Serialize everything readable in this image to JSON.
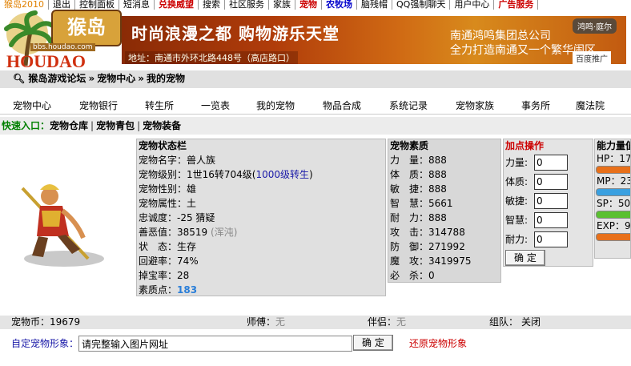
{
  "topnav": {
    "items": [
      "猴岛2010",
      "退出",
      "控制面板",
      "短消息",
      "兑换威望",
      "搜索",
      "社区服务",
      "家族",
      "宠物",
      "农牧场",
      "脑残帽",
      "QQ强制聊天",
      "用户中心",
      "广告服务"
    ]
  },
  "logo": {
    "main": "猴岛",
    "url": "bbs.houdao.com",
    "sub": "HOUDAO"
  },
  "banner": {
    "slogan": "时尚浪漫之都 购物游乐天堂",
    "address": "地址：南通市外环北路448号（高店路口）",
    "company": "南通鸿鸣集团总公司",
    "tagline": "全力打造南通又一个繁华闹区",
    "brand": "鸿鸣·庭尔",
    "ad_tag": "百度推广"
  },
  "breadcrumb": {
    "items": [
      "猴岛游戏论坛",
      "宠物中心",
      "我的宠物"
    ],
    "sep": "»"
  },
  "menu": {
    "items": [
      "宠物中心",
      "宠物银行",
      "转生所",
      "一览表",
      "我的宠物",
      "物品合成",
      "系统记录",
      "宠物家族",
      "事务所",
      "魔法院"
    ]
  },
  "quick": {
    "label": "快速入口：",
    "links": [
      "宠物仓库",
      "宠物青包",
      "宠物装备"
    ],
    "sep": "|"
  },
  "pet_status": {
    "title": "宠物状态栏",
    "name": "宠物名字：兽人族",
    "level_prefix": "宠物级别：1世16转704级(",
    "level_link": "1000级转生",
    "level_suffix": ")",
    "gender": "宠物性别：雄",
    "attribute": "宠物属性：土",
    "loyalty": "忠诚度：-25 猜疑",
    "karma_prefix": "善恶值：38519",
    "karma_tag": "(浑沌)",
    "state": "状　态：生存",
    "evade": "回避率：74%",
    "droprate": "掉宝率：28",
    "points_label": "素质点：",
    "points_value": "183"
  },
  "pet_attr": {
    "title": "宠物素质",
    "rows": [
      {
        "label": "力　量：",
        "value": "888"
      },
      {
        "label": "体　质：",
        "value": "888"
      },
      {
        "label": "敏　捷：",
        "value": "888"
      },
      {
        "label": "智　慧：",
        "value": "5661"
      },
      {
        "label": "耐　力：",
        "value": "888"
      },
      {
        "label": "攻　击：",
        "value": "314788"
      },
      {
        "label": "防　御：",
        "value": "271992"
      },
      {
        "label": "魔　攻：",
        "value": "3419975"
      },
      {
        "label": "必　杀：",
        "value": "0"
      }
    ]
  },
  "add_points": {
    "title": "加点操作",
    "rows": [
      {
        "label": "力量:",
        "value": "0"
      },
      {
        "label": "体质:",
        "value": "0"
      },
      {
        "label": "敏捷:",
        "value": "0"
      },
      {
        "label": "智慧:",
        "value": "0"
      },
      {
        "label": "耐力:",
        "value": "0"
      }
    ],
    "confirm": "确 定"
  },
  "ability": {
    "title": "能力量值",
    "rows": [
      {
        "label": "HP：17",
        "color": "#e8701a"
      },
      {
        "label": "MP：23",
        "color": "#3aa0e0"
      },
      {
        "label": "SP：50",
        "color": "#5ac030"
      },
      {
        "label": "EXP：9",
        "color": "#e8701a"
      }
    ]
  },
  "bottom": {
    "coins": "宠物币：19679",
    "master_label": "师傅：",
    "master_value": "无",
    "partner_label": "伴侣：",
    "partner_value": "无",
    "team_label": "组队：",
    "team_value": "关闭"
  },
  "custom": {
    "label": "自定宠物形象：",
    "input_value": "请完整输入图片网址",
    "confirm": "确 定",
    "restore": "还原宠物形象"
  }
}
